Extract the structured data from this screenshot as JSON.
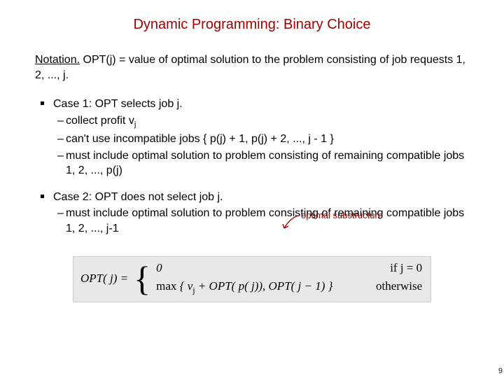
{
  "title": "Dynamic Programming:  Binary Choice",
  "notation": {
    "label": "Notation.",
    "text": "  OPT(j) = value of optimal solution to the problem consisting of job requests 1, 2, ..., j."
  },
  "case1": {
    "head": "Case 1:  OPT selects job j.",
    "items": [
      "collect profit v",
      "can't use incompatible jobs { p(j) + 1, p(j) + 2, ..., j - 1 }",
      "must include optimal solution to problem consisting of remaining compatible jobs 1, 2, ..., p(j)"
    ],
    "subscript_j": "j"
  },
  "case2": {
    "head": "Case 2:  OPT does not select job j.",
    "items": [
      "must include optimal solution to problem consisting of remaining compatible jobs 1, 2, ..., j-1"
    ]
  },
  "annotation": "optimal substructure",
  "formula": {
    "lhs": "OPT( j) =",
    "row1_left": "0",
    "row1_right": "if  j = 0",
    "row2_left_prefix": "max ",
    "row2_left_body": "{ v",
    "row2_left_sub": "j",
    "row2_left_tail": " + OPT( p( j)),  OPT( j − 1) }",
    "row2_right": "otherwise"
  },
  "page": "9"
}
